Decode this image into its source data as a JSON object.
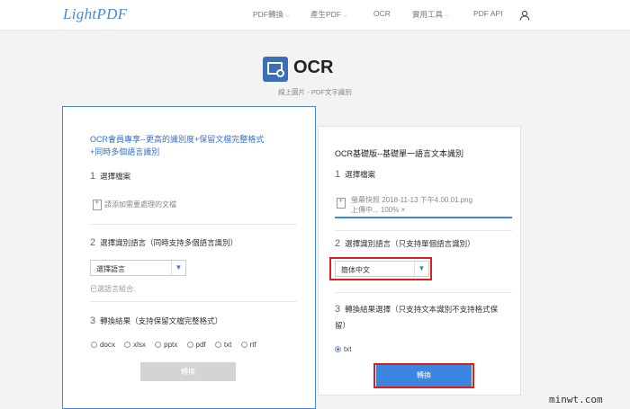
{
  "header": {
    "logo": "LightPDF",
    "nav": [
      {
        "label": "PDF轉換",
        "dropdown": true
      },
      {
        "label": "產生PDF",
        "dropdown": true
      },
      {
        "label": "OCR",
        "dropdown": false
      },
      {
        "label": "實用工具",
        "dropdown": true
      },
      {
        "label": "PDF API",
        "dropdown": false
      }
    ]
  },
  "hero": {
    "title": "OCR",
    "subtitle": "線上圖片 - PDF文字識別"
  },
  "premium": {
    "title_line1": "OCR會員專享--更高的識別度+保留文檔完整格式",
    "title_line2": "+同時多個語言識別",
    "step1": {
      "num": "1",
      "label": "選擇檔案",
      "add_file": "請添加需要處理的文檔"
    },
    "step2": {
      "num": "2",
      "label": "選擇識別語言（同時支持多個語言識別）",
      "select_value": "選擇語言",
      "combo_label": "已選語言組合:"
    },
    "step3": {
      "num": "3",
      "label": "轉換結果（支持保留文檔完整格式）",
      "formats": [
        "docx",
        "xlsx",
        "pptx",
        "pdf",
        "txt",
        "rtf"
      ]
    },
    "button": "轉換"
  },
  "basic": {
    "title": "OCR基礎版--基礎單一語言文本識別",
    "step1": {
      "num": "1",
      "label": "選擇檔案",
      "file_name": "螢幕快照 2018-11-13 下午4.00.01.png",
      "status": "上傳中... 100%",
      "close": "×",
      "progress": 1.0
    },
    "step2": {
      "num": "2",
      "label": "選擇識別語言（只支持單個語言識別）",
      "select_value": "簡体中文"
    },
    "step3": {
      "num": "3",
      "label_line1": "轉換結果選擇（只支持文本識別不支持格式保",
      "label_line2": "留）",
      "formats": [
        "txt"
      ]
    },
    "button": "轉換"
  },
  "watermark": "minwt.com",
  "colors": {
    "accent": "#3b86e0",
    "highlight": "#d9201e",
    "premium_border": "#4a87d6"
  }
}
